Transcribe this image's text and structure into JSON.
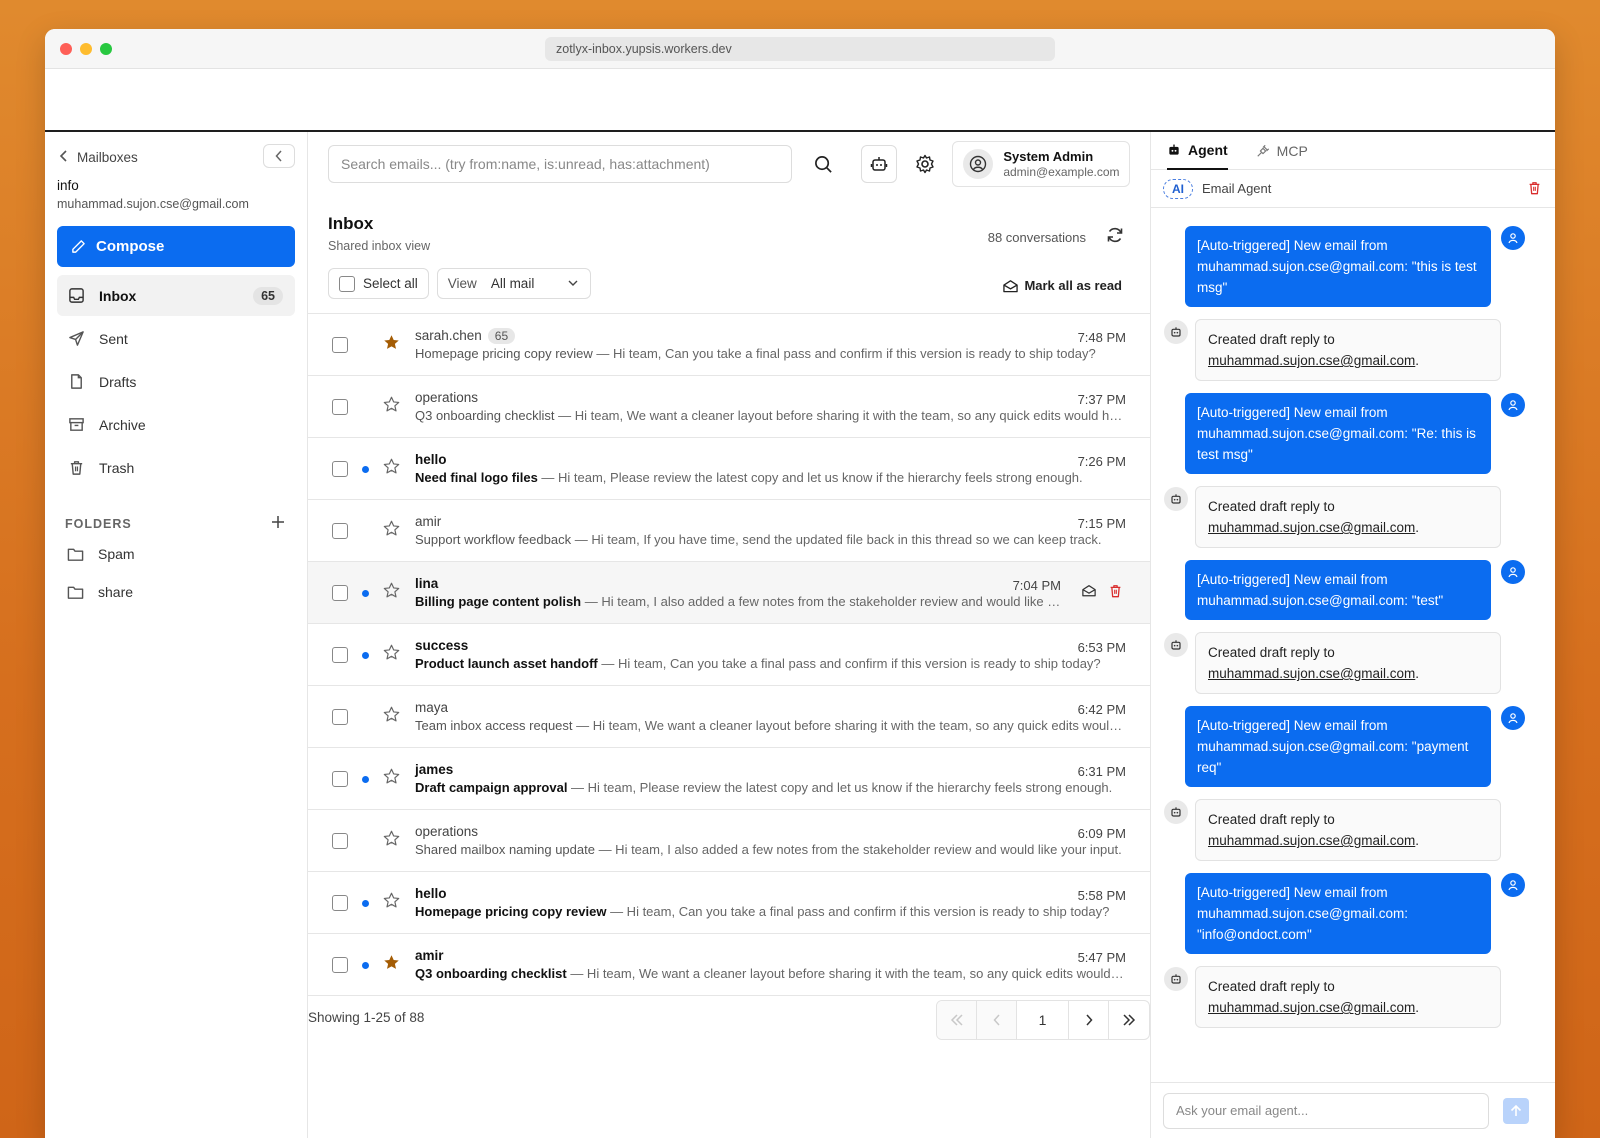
{
  "browser": {
    "url": "zotlyx-inbox.yupsis.workers.dev"
  },
  "sidebar": {
    "back_label": "Mailboxes",
    "mailbox_name": "info",
    "mailbox_email": "muhammad.sujon.cse@gmail.com",
    "compose_label": "Compose",
    "nav": [
      {
        "label": "Inbox",
        "count": "65",
        "icon": "inbox-icon"
      },
      {
        "label": "Sent",
        "icon": "send-icon"
      },
      {
        "label": "Drafts",
        "icon": "file-icon"
      },
      {
        "label": "Archive",
        "icon": "archive-icon"
      },
      {
        "label": "Trash",
        "icon": "trash-icon"
      }
    ],
    "folders_heading": "FOLDERS",
    "folders": [
      {
        "label": "Spam"
      },
      {
        "label": "share"
      }
    ]
  },
  "topbar": {
    "search_placeholder": "Search emails... (try from:name, is:unread, has:attachment)",
    "user_name": "System Admin",
    "user_email": "admin@example.com"
  },
  "inbox": {
    "title": "Inbox",
    "subtitle": "Shared inbox view",
    "conversations": "88 conversations",
    "select_all": "Select all",
    "view_label": "View",
    "view_value": "All mail",
    "mark_all_read": "Mark all as read"
  },
  "emails": [
    {
      "sender": "sarah.chen",
      "badge": "65",
      "time": "7:48 PM",
      "subject": "Homepage pricing copy review",
      "preview": " — Hi team, Can you take a final pass and confirm if this version is ready to ship today?",
      "unread": false,
      "starred": true
    },
    {
      "sender": "operations",
      "time": "7:37 PM",
      "subject": "Q3 onboarding checklist",
      "preview": " — Hi team, We want a cleaner layout before sharing it with the team, so any quick edits would help.",
      "unread": false,
      "starred": false
    },
    {
      "sender": "hello",
      "time": "7:26 PM",
      "subject": "Need final logo files",
      "preview": " — Hi team, Please review the latest copy and let us know if the hierarchy feels strong enough.",
      "unread": true,
      "starred": false
    },
    {
      "sender": "amir",
      "time": "7:15 PM",
      "subject": "Support workflow feedback",
      "preview": " — Hi team, If you have time, send the updated file back in this thread so we can keep track.",
      "unread": false,
      "starred": false
    },
    {
      "sender": "lina",
      "time": "7:04 PM",
      "subject": "Billing page content polish",
      "preview": " — Hi team, I also added a few notes from the stakeholder review and would like your input.",
      "unread": true,
      "starred": false
    },
    {
      "sender": "success",
      "time": "6:53 PM",
      "subject": "Product launch asset handoff",
      "preview": " — Hi team, Can you take a final pass and confirm if this version is ready to ship today?",
      "unread": true,
      "starred": false
    },
    {
      "sender": "maya",
      "time": "6:42 PM",
      "subject": "Team inbox access request",
      "preview": " — Hi team, We want a cleaner layout before sharing it with the team, so any quick edits would help.",
      "unread": false,
      "starred": false
    },
    {
      "sender": "james",
      "time": "6:31 PM",
      "subject": "Draft campaign approval",
      "preview": " — Hi team, Please review the latest copy and let us know if the hierarchy feels strong enough.",
      "unread": true,
      "starred": false
    },
    {
      "sender": "operations",
      "time": "6:09 PM",
      "subject": "Shared mailbox naming update",
      "preview": " — Hi team, I also added a few notes from the stakeholder review and would like your input.",
      "unread": false,
      "starred": false
    },
    {
      "sender": "hello",
      "time": "5:58 PM",
      "subject": "Homepage pricing copy review",
      "preview": " — Hi team, Can you take a final pass and confirm if this version is ready to ship today?",
      "unread": true,
      "starred": false
    },
    {
      "sender": "amir",
      "time": "5:47 PM",
      "subject": "Q3 onboarding checklist",
      "preview": " — Hi team, We want a cleaner layout before sharing it with the team, so any quick edits would help.",
      "unread": true,
      "starred": true
    }
  ],
  "pagination": {
    "showing": "Showing 1-25 of 88",
    "page": "1"
  },
  "agent": {
    "tabs": [
      {
        "label": "Agent"
      },
      {
        "label": "MCP"
      }
    ],
    "ai_badge": "AI",
    "agent_name": "Email Agent",
    "messages": [
      {
        "role": "user",
        "text": "[Auto-triggered] New email from muhammad.sujon.cse@gmail.com: \"this is test msg\""
      },
      {
        "role": "bot",
        "text": "Created draft reply to ",
        "link": "muhammad.sujon.cse@gmail.com",
        "suffix": "."
      },
      {
        "role": "user",
        "text": "[Auto-triggered] New email from muhammad.sujon.cse@gmail.com: \"Re: this is test msg\""
      },
      {
        "role": "bot",
        "text": "Created draft reply to ",
        "link": "muhammad.sujon.cse@gmail.com",
        "suffix": "."
      },
      {
        "role": "user",
        "text": "[Auto-triggered] New email from muhammad.sujon.cse@gmail.com: \"test\""
      },
      {
        "role": "bot",
        "text": "Created draft reply to ",
        "link": "muhammad.sujon.cse@gmail.com",
        "suffix": "."
      },
      {
        "role": "user",
        "text": "[Auto-triggered] New email from muhammad.sujon.cse@gmail.com: \"payment req\""
      },
      {
        "role": "bot",
        "text": "Created draft reply to ",
        "link": "muhammad.sujon.cse@gmail.com",
        "suffix": "."
      },
      {
        "role": "user",
        "text": "[Auto-triggered] New email from muhammad.sujon.cse@gmail.com: \"info@ondoct.com\""
      },
      {
        "role": "bot",
        "text": "Created draft reply to ",
        "link": "muhammad.sujon.cse@gmail.com",
        "suffix": "."
      }
    ],
    "input_placeholder": "Ask your email agent..."
  },
  "colors": {
    "accent": "#0b6cf0",
    "star": "#a45c04",
    "danger": "#d92d2d"
  }
}
